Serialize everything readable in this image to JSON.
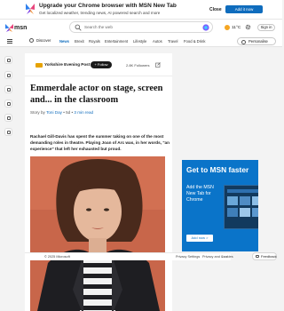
{
  "banner": {
    "title": "Upgrade your Chrome browser with MSN New Tab",
    "subtitle": "Get localized weather, trending news, AI powered search and more",
    "close_label": "Close",
    "add_label": "Add it now"
  },
  "header": {
    "logo_text": "msn",
    "search_placeholder": "Search the web",
    "weather": "11°C",
    "signin_label": "Sign in"
  },
  "nav": {
    "discover": "Discover",
    "items": [
      {
        "label": "News",
        "active": true
      },
      {
        "label": "Brexit",
        "active": false
      },
      {
        "label": "Royals",
        "active": false
      },
      {
        "label": "Entertainment",
        "active": false
      },
      {
        "label": "Lifestyle",
        "active": false
      },
      {
        "label": "Autos",
        "active": false
      },
      {
        "label": "Travel",
        "active": false
      },
      {
        "label": "Food & Drink",
        "active": false
      }
    ],
    "personalize_label": "Personalise"
  },
  "article": {
    "publisher": "Yorkshire Evening Post",
    "follow_label": "+ Follow",
    "followers": "2.8K Followers",
    "headline": "Emmerdale actor on stage, screen and... in the classroom",
    "byline_prefix": "Story by",
    "author": "Toni Day",
    "age": "• 5d •",
    "read_time": "3 min read",
    "lead": "Rachael Gill-Davis has spent the summer taking on one of the most demanding roles in theatre. Playing Joan of Arc was, in her words, \"an experience\" that left her exhausted but proud."
  },
  "footer": {
    "copyright": "© 2025 Microsoft",
    "privacy_settings": "Privacy Settings",
    "privacy_cookies": "Privacy and Cookies",
    "more": "• • •",
    "feedback": "Feedback"
  },
  "ad": {
    "headline": "Get to MSN faster",
    "text": "Add the MSN New Tab for Chrome",
    "button": "Add now >"
  },
  "colors": {
    "accent": "#0f6cbd",
    "ad_background": "#0a74c9",
    "photo_background": "#c8664a"
  }
}
